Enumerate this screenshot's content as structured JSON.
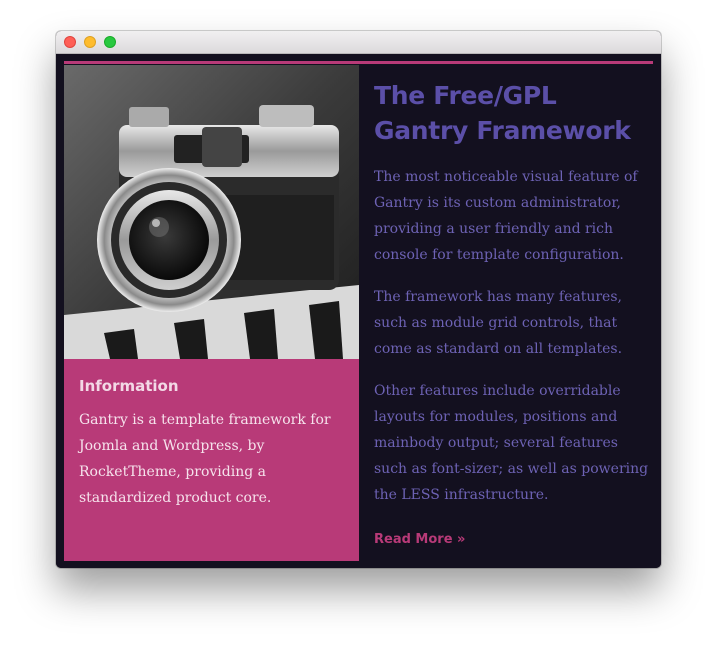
{
  "window": {
    "controls": [
      "close",
      "minimize",
      "zoom"
    ]
  },
  "feature": {
    "image_alt": "camera photo",
    "info_title": "Information",
    "info_text": "Gantry is a template framework for Joomla and Wordpress, by RocketTheme, providing a standardized product core."
  },
  "main": {
    "title": "The Free/GPL Gantry Framework",
    "paragraphs": [
      "The most noticeable visual feature of Gantry is its custom administrator, providing a user friendly and rich console for template configuration.",
      "The framework has many features, such as module grid controls, that come as standard on all templates.",
      "Other features include overridable layouts for modules, positions and mainbody output; several features such as font-sizer; as well as powering the LESS infrastructure."
    ],
    "read_more": "Read More »"
  },
  "colors": {
    "accent": "#b83a78",
    "background": "#13101f",
    "heading": "#5b4fa8",
    "body_text": "#6d62b4"
  }
}
